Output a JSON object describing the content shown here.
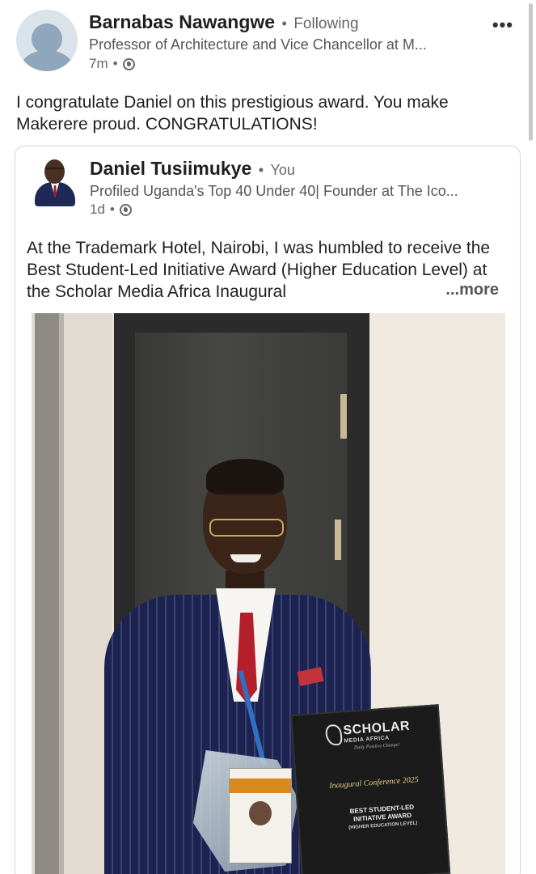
{
  "post": {
    "author": "Barnabas Nawangwe",
    "follow_status": "Following",
    "separator": "•",
    "headline": "Professor of Architecture and Vice Chancellor at M...",
    "time": "7m",
    "commentary": "I congratulate Daniel on this prestigious award. You make Makerere proud. CONGRATULATIONS!",
    "menu_label": "•••"
  },
  "shared": {
    "author": "Daniel Tusiimukye",
    "relation": "You",
    "separator": "•",
    "headline": "Profiled Uganda's Top 40 Under 40| Founder at The Ico...",
    "time": "1d",
    "text": "At the Trademark Hotel, Nairobi, I was humbled to receive the Best Student-Led Initiative Award (Higher Education Level) at the Scholar Media Africa Inaugural",
    "see_more": "...more"
  },
  "photo": {
    "folder_brand": "SCHOLAR",
    "folder_brand_sub": "MEDIA AFRICA",
    "folder_tagline": "Daily Positive Change!",
    "folder_conference": "Inaugural Conference 2025",
    "folder_award": "BEST STUDENT-LED INITIATIVE AWARD",
    "folder_level": "(HIGHER EDUCATION LEVEL)"
  },
  "icons": {
    "visibility": "globe-icon",
    "menu": "more-horizontal-icon"
  },
  "colors": {
    "background": "#ffffff",
    "text_primary": "#1f1f1f",
    "text_secondary": "#666666",
    "card_border": "#d6d6d6"
  }
}
